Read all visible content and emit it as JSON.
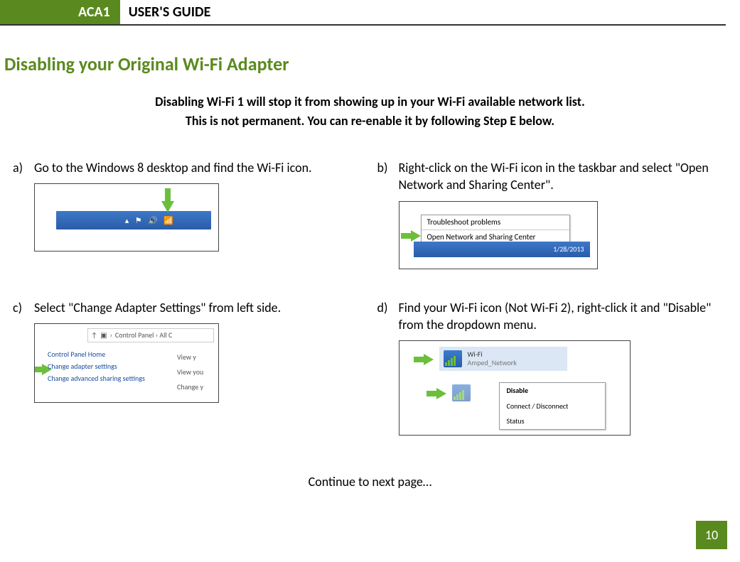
{
  "header": {
    "model": "ACA1",
    "title": "USER'S GUIDE"
  },
  "section_title": "Disabling your Original Wi-Fi Adapter",
  "intro_line1": "Disabling Wi-Fi 1 will stop it from showing up in your Wi-Fi available network list.",
  "intro_line2": "This is not permanent. You can re-enable it by following Step E below.",
  "steps": {
    "a": {
      "label": "a)",
      "text": "Go to the Windows 8 desktop and find the Wi-Fi icon."
    },
    "b": {
      "label": "b)",
      "text": "Right-click on the Wi-Fi icon in the taskbar and select \"Open Network and Sharing Center\"."
    },
    "c": {
      "label": "c)",
      "text": "Select \"Change Adapter Settings\" from left side."
    },
    "d": {
      "label": "d)",
      "text": "Find your Wi-Fi icon (Not Wi-Fi 2), right-click it and \"Disable\" from the dropdown menu."
    }
  },
  "shot_b": {
    "menu_item1": "Troubleshoot problems",
    "menu_item2": "Open Network and Sharing Center",
    "date": "1/28/2013"
  },
  "shot_c": {
    "crumb": "Control Panel  ›  All C",
    "home": "Control Panel Home",
    "link1": "Change adapter settings",
    "link2": "Change advanced sharing settings",
    "r1": "View y",
    "r2": "View you",
    "r3": "Change y"
  },
  "shot_d": {
    "wifi_name": "Wi-Fi",
    "wifi_net": "Amped_Network",
    "menu_disable": "Disable",
    "menu_connect": "Connect / Disconnect",
    "menu_status": "Status"
  },
  "continue_text": "Continue to next page…",
  "page_number": "10"
}
